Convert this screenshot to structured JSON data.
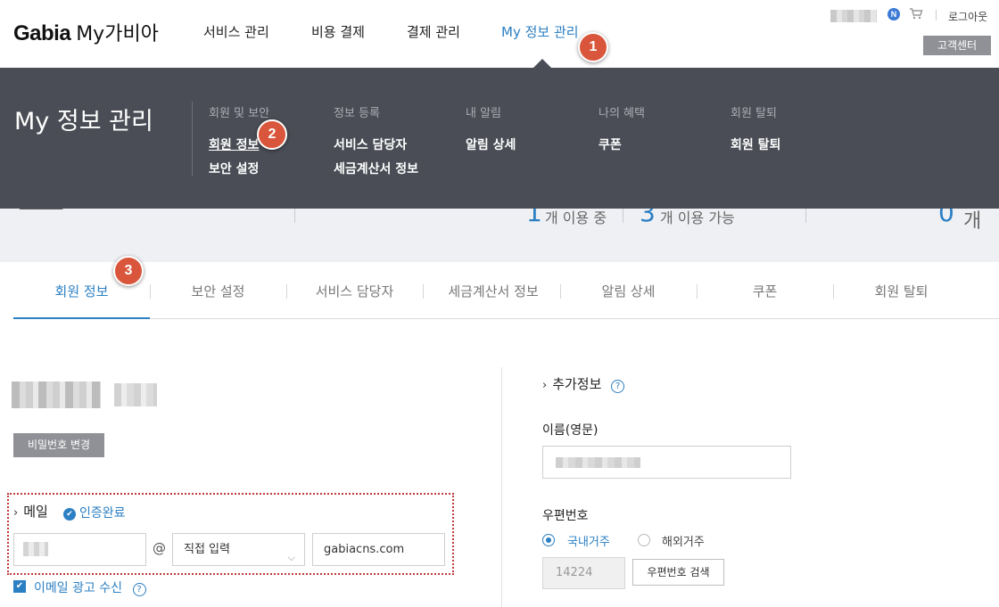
{
  "header": {
    "logo_brand": "Gabia",
    "logo_sub": "My가비아",
    "nav": [
      "서비스 관리",
      "비용 결제",
      "결제 관리",
      "My 정보 관리"
    ],
    "logout": "로그아웃",
    "customer_center": "고객센터",
    "notification_badge": "N"
  },
  "mega_menu": {
    "title": "My 정보 관리",
    "groups": [
      {
        "heading": "회원 및 보안",
        "links": [
          "회원 정보",
          "보안 설정"
        ]
      },
      {
        "heading": "정보 등록",
        "links": [
          "서비스 담당자",
          "세금계산서 정보"
        ]
      },
      {
        "heading": "내 알림",
        "links": [
          "알림 상세"
        ]
      },
      {
        "heading": "나의 혜택",
        "links": [
          "쿠폰"
        ]
      },
      {
        "heading": "회원 탈퇴",
        "links": [
          "회원 탈퇴"
        ]
      }
    ]
  },
  "summary_band": {
    "in_use_count": "1",
    "in_use_label": "개 이용 중",
    "available_count": "3",
    "available_label": "개 이용 가능",
    "right_count": "0",
    "right_unit": "개"
  },
  "tabs": [
    "회원 정보",
    "보안 설정",
    "서비스 담당자",
    "세금계산서 정보",
    "알림 상세",
    "쿠폰",
    "회원 탈퇴"
  ],
  "annotations": [
    "1",
    "2",
    "3"
  ],
  "profile": {
    "password_button": "비밀번호 변경"
  },
  "email": {
    "title": "메일",
    "verified_label": "인증완료",
    "domain_select": "직접 입력",
    "domain_value": "gabiacns.com",
    "ad_consent_label": "이메일 광고 수신",
    "ad_consent_checked": true
  },
  "extra": {
    "title": "추가정보",
    "english_name_label": "이름(영문)",
    "postcode_label": "우편번호",
    "radio_domestic": "국내거주",
    "radio_overseas": "해외거주",
    "postcode_value": "14224",
    "postcode_search": "우편번호 검색"
  },
  "colors": {
    "accent": "#2b7fc3",
    "menu_bg": "#4a4d55",
    "badge": "#d9553b"
  }
}
